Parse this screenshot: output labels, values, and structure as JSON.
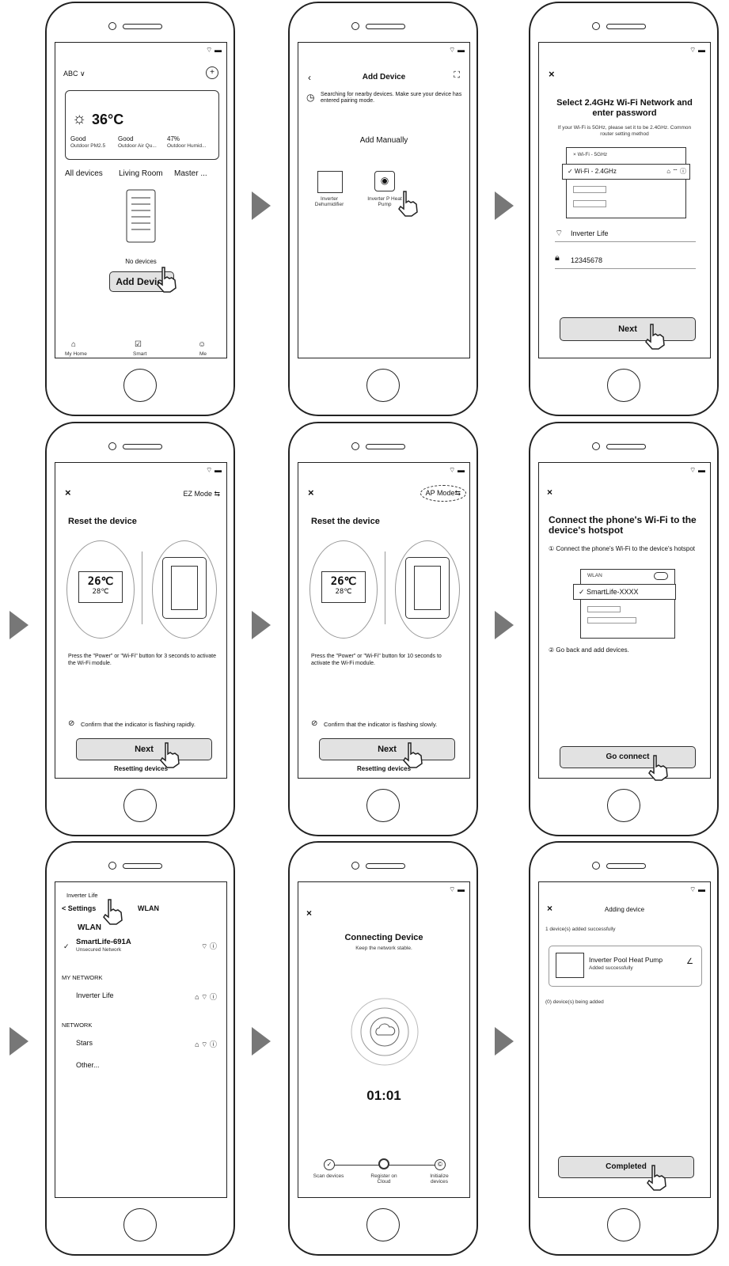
{
  "p1": {
    "home_name": "ABC ∨",
    "temp": "36°C",
    "stat1_val": "Good",
    "stat1_lbl": "Outdoor PM2.5",
    "stat2_val": "Good",
    "stat2_lbl": "Outdoor Air Qu...",
    "stat3_val": "47%",
    "stat3_lbl": "Outdoor Humid...",
    "tabs": [
      "All devices",
      "Living Room",
      "Master ..."
    ],
    "empty": "No devices",
    "add_btn": "Add  Device",
    "nav": [
      "My Home",
      "Smart",
      "Me"
    ]
  },
  "p2": {
    "title": "Add  Device",
    "searching": "Searching for nearby devices. Make sure your device has entered pairing mode.",
    "manual": "Add Manually",
    "dev1": "Inverter Dehumidifier",
    "dev2": "Inverter P Heat Pump"
  },
  "p3": {
    "title": "Select 2.4GHz Wi-Fi Network and enter password",
    "hint": "If your Wi-Fi is 5GHz, please set it to be 2.4GHz. Common router setting method",
    "net5": "× Wi-Fi - 5GHz",
    "net24": "✓ Wi-Fi - 2.4GHz",
    "ssid": "Inverter Life",
    "password": "12345678",
    "next": "Next"
  },
  "p4": {
    "mode": "EZ Mode ⇆",
    "title": "Reset the device",
    "lcd1": "26℃",
    "lcd2": "28℃",
    "instruction": "Press the \"Power\" or \"Wi-Fi\" button for 3 seconds to activate the Wi-Fi module.",
    "confirm": "Confirm that the indicator is flashing rapidly.",
    "next": "Next",
    "sub": "Resetting devices"
  },
  "p5": {
    "mode": "AP Mode⇆",
    "title": "Reset the device",
    "lcd1": "26℃",
    "lcd2": "28℃",
    "instruction": "Press the \"Power\" or \"Wi-Fi\" button for 10 seconds to activate the Wi-Fi module.",
    "confirm": "Confirm that the indicator is flashing slowly.",
    "next": "Next",
    "sub": "Resetting devices"
  },
  "p6": {
    "title": "Connect the phone's Wi-Fi to the device's hotspot",
    "step1": "① Connect the phone's Wi-Fi to the device's hotspot",
    "wlan": "WLAN",
    "hotspot": "✓ SmartLife-XXXX",
    "step2": "② Go back and add devices.",
    "btn": "Go connect"
  },
  "p7": {
    "top": "Inverter Life",
    "back": "< Settings",
    "wlan_head": "WLAN",
    "section": "WLAN",
    "hotspot": "SmartLife-691A",
    "hotspot_sub": "Unsecured Network",
    "mynet": "MY NETWORK",
    "mynet_item": "Inverter Life",
    "network": "NETWORK",
    "net1": "Stars",
    "net2": "Other..."
  },
  "p8": {
    "title": "Connecting Device",
    "sub": "Keep the network stable.",
    "timer": "01:01",
    "steps": [
      "Scan devices",
      "Register on Cloud",
      "Initialize devices"
    ]
  },
  "p9": {
    "title": "Adding device",
    "success": "1 device(s) added successfully",
    "device": "Inverter Pool Heat Pump",
    "device_sub": "Added successfully",
    "pending": "(0) device(s) being added",
    "btn": "Completed"
  },
  "colors": {
    "line": "#222222",
    "button": "#e2e2e2",
    "arrow": "#777777"
  }
}
